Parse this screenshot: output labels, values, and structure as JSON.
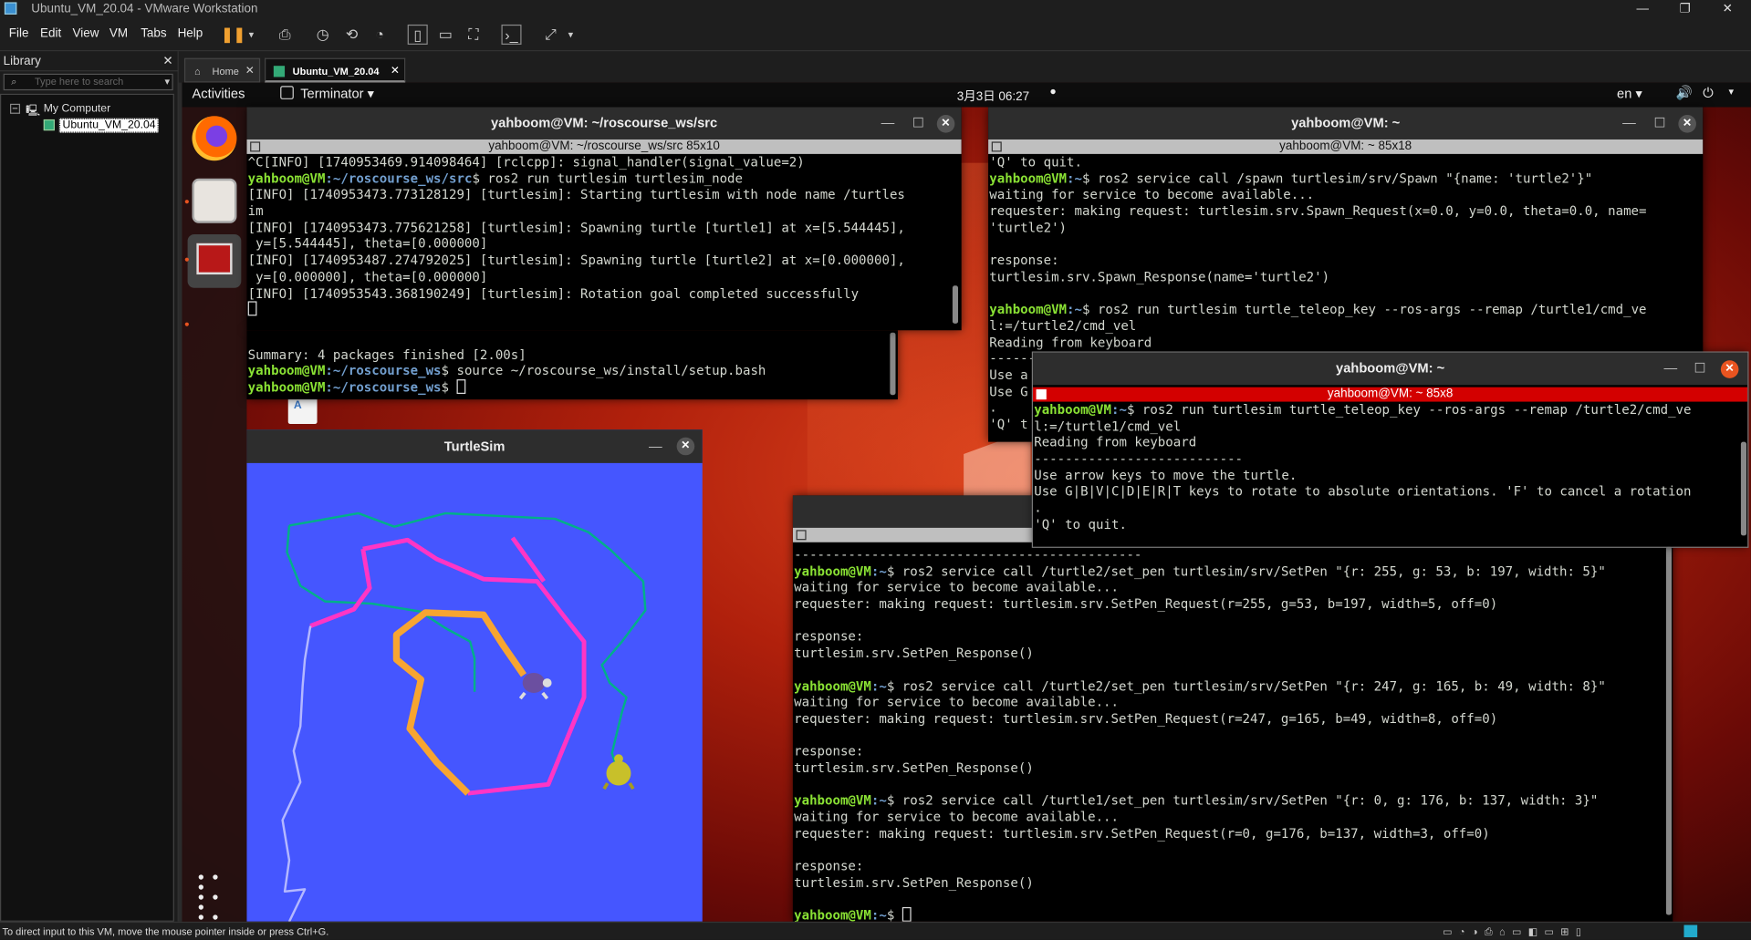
{
  "vmware": {
    "title": "Ubuntu_VM_20.04 - VMware Workstation",
    "menu": [
      "File",
      "Edit",
      "View",
      "VM",
      "Tabs",
      "Help"
    ],
    "library_title": "Library",
    "search_placeholder": "Type here to search",
    "tree_root": "My Computer",
    "tree_child": "Ubuntu_VM_20.04",
    "tab_home": "Home",
    "tab_vm": "Ubuntu_VM_20.04",
    "status": "To direct input to this VM, move the mouse pointer inside or press Ctrl+G."
  },
  "ubuntu": {
    "activities": "Activities",
    "app_menu": "Terminator",
    "datetime": "3月3日  06:27",
    "lang": "en"
  },
  "win1": {
    "title": "yahboom@VM: ~/roscourse_ws/src",
    "subtitle": "yahboom@VM: ~/roscourse_ws/src 85x10",
    "lines": [
      {
        "t": "^C[INFO] [1740953469.914098464] [rclcpp]: signal_handler(signal_value=2)"
      },
      {
        "u": "yahboom@VM",
        "p": ":~/roscourse_ws/src",
        "t": "$ ros2 run turtlesim turtlesim_node"
      },
      {
        "t": "[INFO] [1740953473.773128129] [turtlesim]: Starting turtlesim with node name /turtles"
      },
      {
        "t": "im"
      },
      {
        "t": "[INFO] [1740953473.775621258] [turtlesim]: Spawning turtle [turtle1] at x=[5.544445],"
      },
      {
        "t": " y=[5.544445], theta=[0.000000]"
      },
      {
        "t": "[INFO] [1740953487.274792025] [turtlesim]: Spawning turtle [turtle2] at x=[0.000000],"
      },
      {
        "t": " y=[0.000000], theta=[0.000000]"
      },
      {
        "t": "[INFO] [1740953543.368190249] [turtlesim]: Rotation goal completed successfully"
      }
    ]
  },
  "win_back": {
    "lines": [
      {
        "t": ""
      },
      {
        "t": "Summary: 4 packages finished [2.00s]"
      },
      {
        "u": "yahboom@VM",
        "p": ":~/roscourse_ws",
        "t": "$ source ~/roscourse_ws/install/setup.bash"
      },
      {
        "u": "yahboom@VM",
        "p": ":~/roscourse_ws",
        "t": "$ "
      }
    ]
  },
  "win2": {
    "title": "yahboom@VM: ~",
    "subtitle": "yahboom@VM: ~ 85x18",
    "lines": [
      {
        "t": "'Q' to quit."
      },
      {
        "u": "yahboom@VM",
        "p": ":~",
        "t": "$ ros2 service call /spawn turtlesim/srv/Spawn \"{name: 'turtle2'}\""
      },
      {
        "t": "waiting for service to become available..."
      },
      {
        "t": "requester: making request: turtlesim.srv.Spawn_Request(x=0.0, y=0.0, theta=0.0, name="
      },
      {
        "t": "'turtle2')"
      },
      {
        "t": ""
      },
      {
        "t": "response:"
      },
      {
        "t": "turtlesim.srv.Spawn_Response(name='turtle2')"
      },
      {
        "t": ""
      },
      {
        "u": "yahboom@VM",
        "p": ":~",
        "t": "$ ros2 run turtlesim turtle_teleop_key --ros-args --remap /turtle1/cmd_ve"
      },
      {
        "t": "l:=/turtle2/cmd_vel"
      },
      {
        "t": "Reading from keyboard"
      },
      {
        "t": "---------------------------"
      },
      {
        "t": "Use a"
      },
      {
        "t": "Use G"
      },
      {
        "t": "."
      },
      {
        "t": "'Q' t"
      }
    ]
  },
  "win3": {
    "title": "yahboom@VM: ~",
    "subtitle": "yahboom@VM: ~ 85x8",
    "lines": [
      {
        "u": "yahboom@VM",
        "p": ":~",
        "t": "$ ros2 run turtlesim turtle_teleop_key --ros-args --remap /turtle2/cmd_ve"
      },
      {
        "t": "l:=/turtle1/cmd_vel"
      },
      {
        "t": "Reading from keyboard"
      },
      {
        "t": "---------------------------"
      },
      {
        "t": "Use arrow keys to move the turtle."
      },
      {
        "t": "Use G|B|V|C|D|E|R|T keys to rotate to absolute orientations. 'F' to cancel a rotation"
      },
      {
        "t": "."
      },
      {
        "t": "'Q' to quit."
      }
    ]
  },
  "win4": {
    "lines": [
      {
        "t": "---------------------------------------------"
      },
      {
        "u": "yahboom@VM",
        "p": ":~",
        "t": "$ ros2 service call /turtle2/set_pen turtlesim/srv/SetPen \"{r: 255, g: 53, b: 197, width: 5}\""
      },
      {
        "t": "waiting for service to become available..."
      },
      {
        "t": "requester: making request: turtlesim.srv.SetPen_Request(r=255, g=53, b=197, width=5, off=0)"
      },
      {
        "t": ""
      },
      {
        "t": "response:"
      },
      {
        "t": "turtlesim.srv.SetPen_Response()"
      },
      {
        "t": ""
      },
      {
        "u": "yahboom@VM",
        "p": ":~",
        "t": "$ ros2 service call /turtle2/set_pen turtlesim/srv/SetPen \"{r: 247, g: 165, b: 49, width: 8}\""
      },
      {
        "t": "waiting for service to become available..."
      },
      {
        "t": "requester: making request: turtlesim.srv.SetPen_Request(r=247, g=165, b=49, width=8, off=0)"
      },
      {
        "t": ""
      },
      {
        "t": "response:"
      },
      {
        "t": "turtlesim.srv.SetPen_Response()"
      },
      {
        "t": ""
      },
      {
        "u": "yahboom@VM",
        "p": ":~",
        "t": "$ ros2 service call /turtle1/set_pen turtlesim/srv/SetPen \"{r: 0, g: 176, b: 137, width: 3}\""
      },
      {
        "t": "waiting for service to become available..."
      },
      {
        "t": "requester: making request: turtlesim.srv.SetPen_Request(r=0, g=176, b=137, width=3, off=0)"
      },
      {
        "t": ""
      },
      {
        "t": "response:"
      },
      {
        "t": "turtlesim.srv.SetPen_Response()"
      },
      {
        "t": ""
      },
      {
        "u": "yahboom@VM",
        "p": ":~",
        "t": "$ "
      }
    ]
  },
  "turtlesim": {
    "title": "TurtleSim",
    "background": "#4556ff",
    "colors": {
      "green": "#00b089",
      "pink": "#ff35c5",
      "orange": "#f7a531",
      "white": "#b4b8ff"
    }
  }
}
